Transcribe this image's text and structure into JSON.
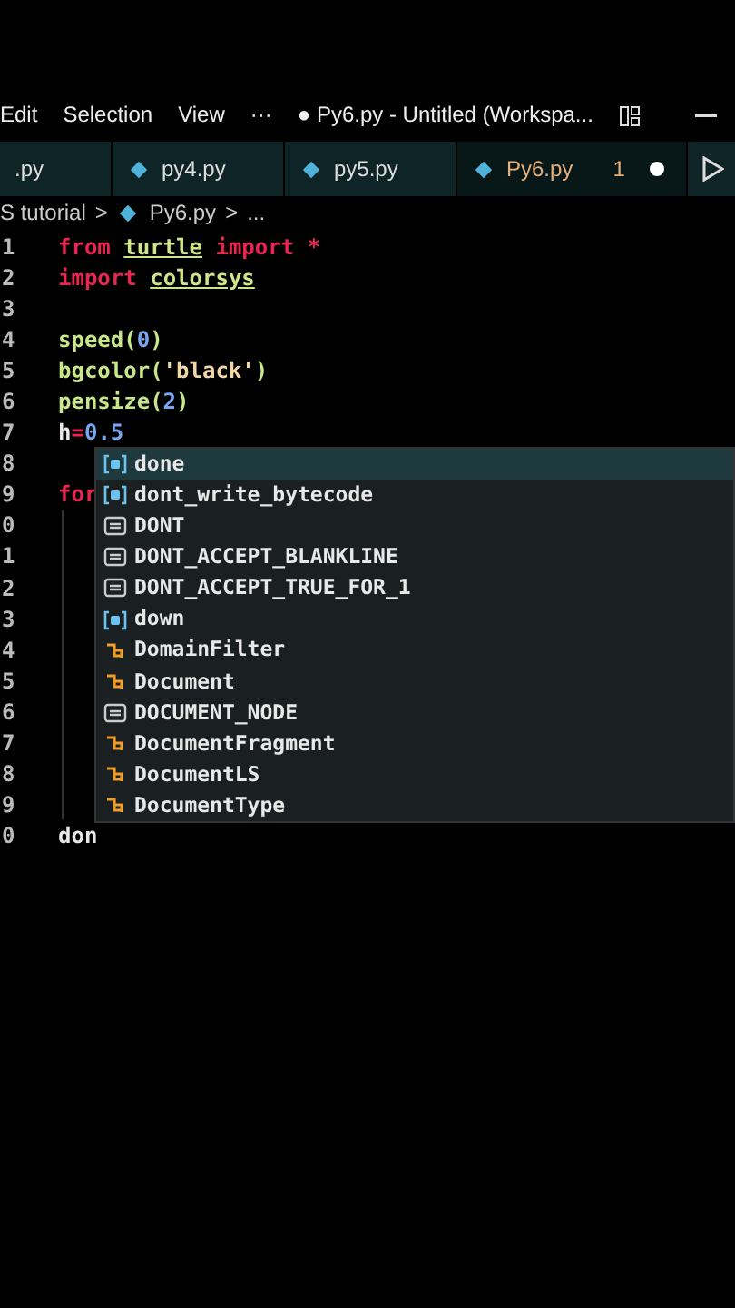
{
  "menu": [
    "Edit",
    "Selection",
    "View",
    "···"
  ],
  "window": {
    "title": "● Py6.py - Untitled (Workspa..."
  },
  "tabs": [
    {
      "label": ".py",
      "selected": false,
      "icon": false,
      "modified": false
    },
    {
      "label": "py4.py",
      "selected": false,
      "icon": true,
      "modified": false
    },
    {
      "label": "py5.py",
      "selected": false,
      "icon": true,
      "modified": false
    },
    {
      "label": "Py6.py",
      "selected": true,
      "icon": true,
      "count": "1",
      "modified": true
    }
  ],
  "breadcrumb": [
    {
      "kind": "folder",
      "text": "S tutorial"
    },
    {
      "kind": "separator",
      "text": ">"
    },
    {
      "kind": "file",
      "text": "Py6.py"
    },
    {
      "kind": "separator",
      "text": ">"
    },
    {
      "kind": "folder",
      "text": "..."
    }
  ],
  "code": [
    {
      "number": "1",
      "tokens": [
        {
          "kind": "keyword",
          "text": "from"
        },
        {
          "kind": "module",
          "text": "turtle"
        },
        {
          "kind": "keyword",
          "text": "import"
        },
        {
          "kind": "keyword",
          "text": "*"
        }
      ]
    },
    {
      "number": "2",
      "tokens": [
        {
          "kind": "keyword",
          "text": "import"
        },
        {
          "kind": "module",
          "text": "colorsys"
        }
      ]
    },
    {
      "number": "3"
    },
    {
      "number": "4",
      "tokens": [
        {
          "kind": "func",
          "text": "speed("
        },
        {
          "kind": "number",
          "text": "0"
        },
        {
          "kind": "func",
          "text": ")"
        }
      ]
    },
    {
      "number": "5",
      "tokens": [
        {
          "kind": "func",
          "text": "bgcolor("
        },
        {
          "kind": "string",
          "text": "'black'"
        },
        {
          "kind": "func",
          "text": ")"
        }
      ]
    },
    {
      "number": "6",
      "tokens": [
        {
          "kind": "func",
          "text": "pensize("
        },
        {
          "kind": "number",
          "text": "2"
        },
        {
          "kind": "func",
          "text": ")"
        }
      ]
    },
    {
      "number": "7",
      "tokens": [
        {
          "kind": "plain",
          "text": "h"
        },
        {
          "kind": "keyword",
          "text": "="
        },
        {
          "kind": "number",
          "text": "0.5"
        }
      ]
    },
    {
      "number": "8"
    },
    {
      "number": "9",
      "tokens": [
        {
          "kind": "keyword",
          "text": "for"
        }
      ]
    },
    {
      "number": "0"
    },
    {
      "number": "1"
    },
    {
      "number": "2"
    },
    {
      "number": "3"
    },
    {
      "number": "4"
    },
    {
      "number": "5"
    },
    {
      "number": "6"
    },
    {
      "number": "7"
    },
    {
      "number": "8"
    },
    {
      "number": "9"
    },
    {
      "number": "0",
      "tokens": [
        {
          "kind": "plain",
          "text": "don"
        }
      ]
    }
  ],
  "suggestions": [
    {
      "label": "done",
      "kind": "variable",
      "selected": true
    },
    {
      "label": "dont_write_bytecode",
      "kind": "variable",
      "selected": false
    },
    {
      "label": "DONT",
      "kind": "constant",
      "selected": false
    },
    {
      "label": "DONT_ACCEPT_BLANKLINE",
      "kind": "constant",
      "selected": false
    },
    {
      "label": "DONT_ACCEPT_TRUE_FOR_1",
      "kind": "constant",
      "selected": false
    },
    {
      "label": "down",
      "kind": "variable",
      "selected": false
    },
    {
      "label": "DomainFilter",
      "kind": "class",
      "selected": false
    },
    {
      "label": "Document",
      "kind": "class",
      "selected": false
    },
    {
      "label": "DOCUMENT_NODE",
      "kind": "constant",
      "selected": false
    },
    {
      "label": "DocumentFragment",
      "kind": "class",
      "selected": false
    },
    {
      "label": "DocumentLS",
      "kind": "class",
      "selected": false
    },
    {
      "label": "DocumentType",
      "kind": "class",
      "selected": false
    }
  ]
}
